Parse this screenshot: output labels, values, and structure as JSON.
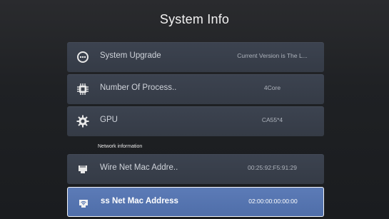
{
  "title": "System Info",
  "rows": [
    {
      "label": "System Upgrade",
      "value": "Current Version is The L...",
      "icon": "upgrade-icon"
    },
    {
      "label": "Number Of Process..",
      "value": "4Core",
      "icon": "processor-chip-icon"
    },
    {
      "label": "GPU",
      "value": "CA55*4",
      "icon": "gpu-gear-icon"
    }
  ],
  "section": "Network information",
  "network_rows": [
    {
      "label": "Wire Net Mac Addre..",
      "value": "00:25:92:F5:91:29",
      "icon": "ethernet-icon"
    },
    {
      "label": "ss Net Mac Address",
      "value": "02:00:00:00:00:00",
      "icon": "wireless-icon"
    }
  ],
  "colors": {
    "selected_bg": "#5574af",
    "row_bg": "#383e49",
    "background": "#1f2124"
  }
}
